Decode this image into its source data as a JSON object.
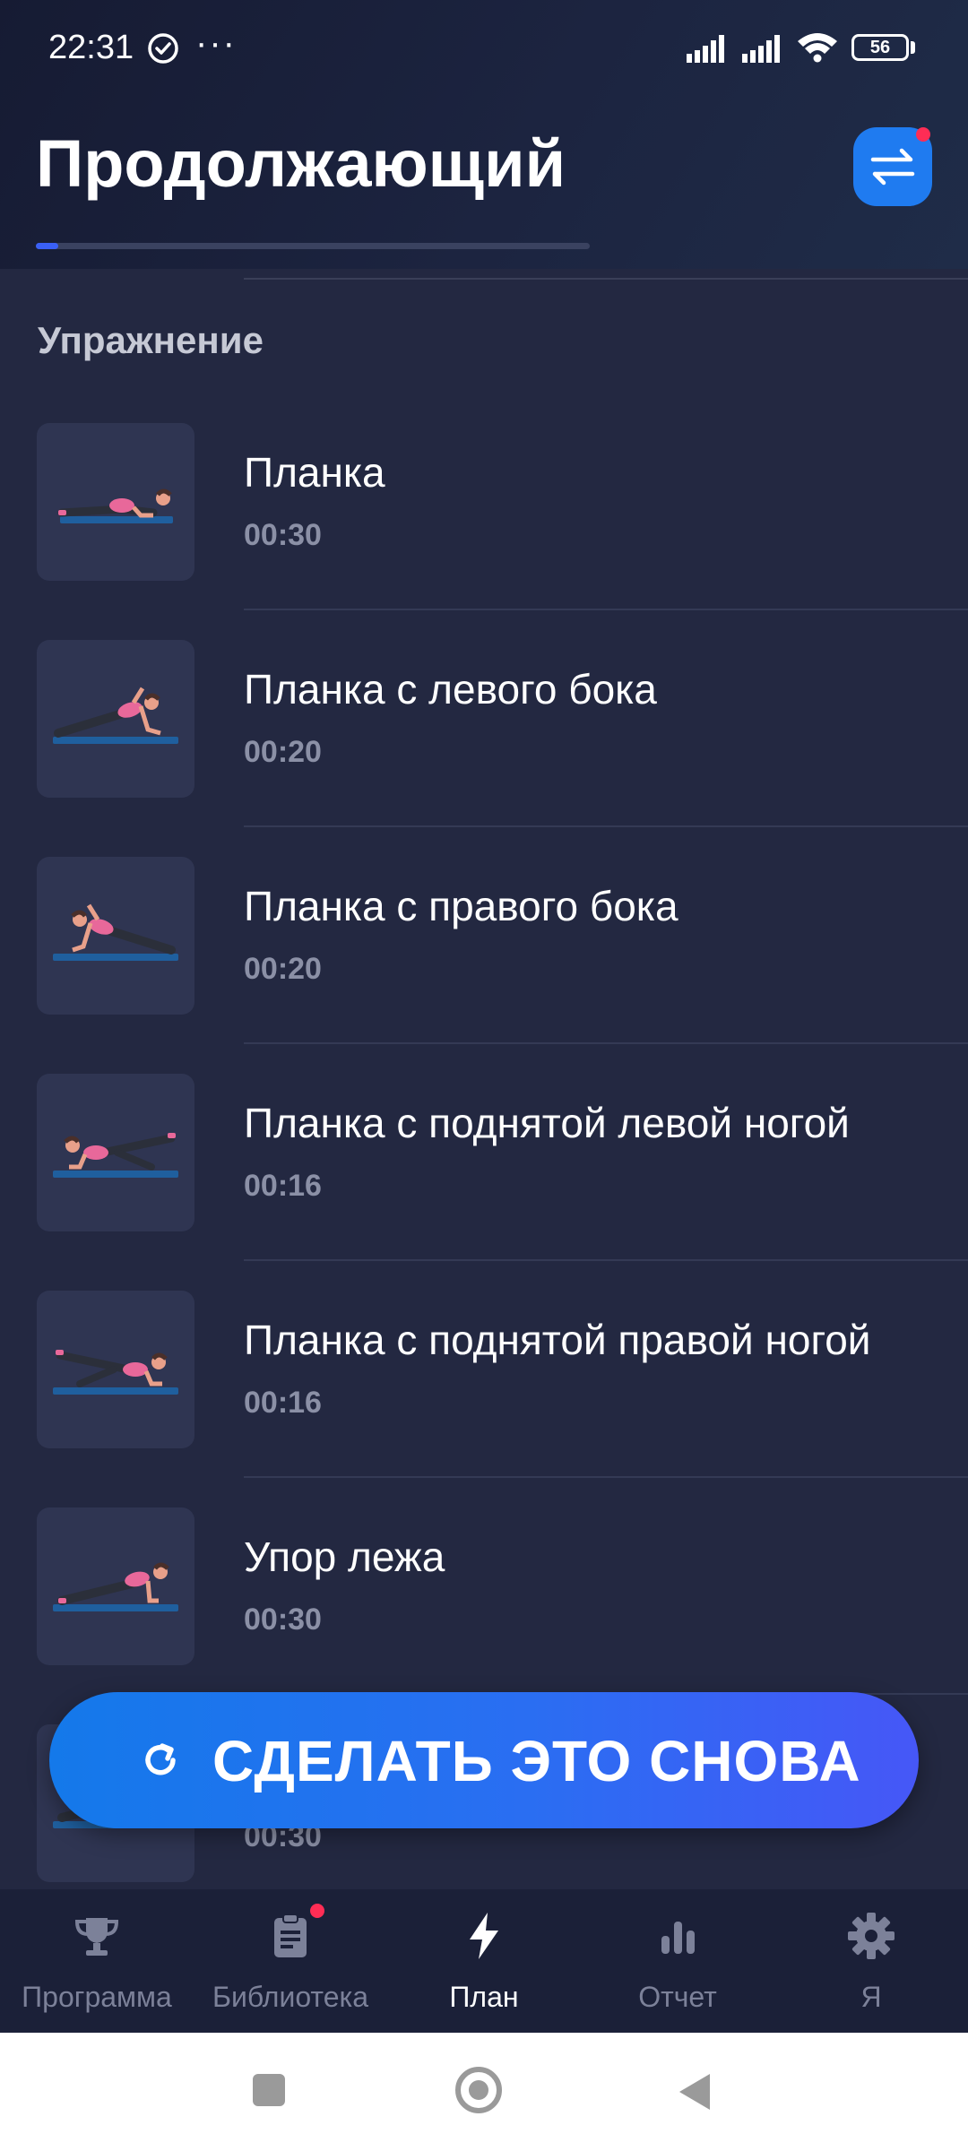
{
  "status_bar": {
    "time": "22:31",
    "overflow": "···",
    "battery": "56"
  },
  "header": {
    "title": "Продолжающий",
    "switch_icon": "swap-arrows-icon",
    "progress_fraction": 0.04
  },
  "section": {
    "label": "Упражнение"
  },
  "exercises": [
    {
      "name": "Планка",
      "duration": "00:30"
    },
    {
      "name": "Планка с левого бока",
      "duration": "00:20"
    },
    {
      "name": "Планка с правого бока",
      "duration": "00:20"
    },
    {
      "name": "Планка с поднятой левой ногой",
      "duration": "00:16"
    },
    {
      "name": "Планка с поднятой правой ногой",
      "duration": "00:16"
    },
    {
      "name": "Упор лежа",
      "duration": "00:30"
    },
    {
      "name": "",
      "duration": "00:30"
    }
  ],
  "redo_button": {
    "label": "СДЕЛАТЬ ЭТО СНОВА",
    "icon": "refresh-icon"
  },
  "bottom_nav": [
    {
      "label": "Программа",
      "icon": "trophy-icon"
    },
    {
      "label": "Библиотека",
      "icon": "clipboard-icon"
    },
    {
      "label": "План",
      "icon": "lightning-icon"
    },
    {
      "label": "Отчет",
      "icon": "bar-chart-icon"
    },
    {
      "label": "Я",
      "icon": "gear-icon"
    }
  ],
  "colors": {
    "background": "#232841",
    "accent": "#1f7bf0",
    "badge": "#ff2d55"
  }
}
